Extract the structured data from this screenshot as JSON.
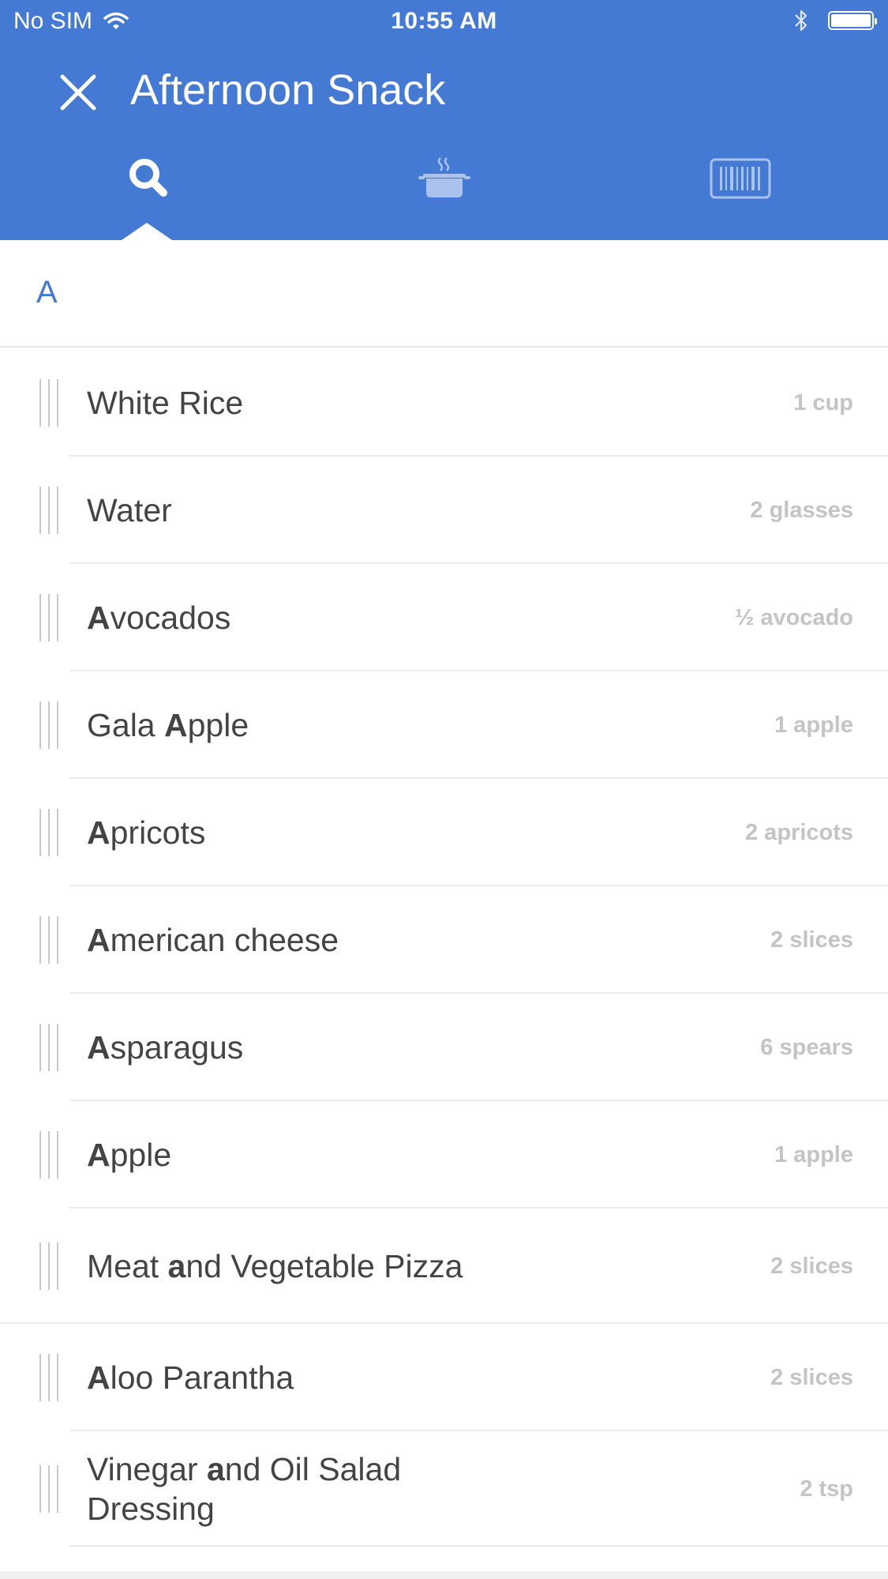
{
  "status_bar": {
    "carrier": "No SIM",
    "time": "10:55 AM",
    "wifi_icon": "wifi-icon",
    "bluetooth_icon": "bluetooth-icon",
    "battery_icon": "battery-icon"
  },
  "header": {
    "title": "Afternoon Snack",
    "close_icon": "close-icon",
    "tabs": [
      {
        "icon": "search-icon",
        "selected": true
      },
      {
        "icon": "cooking-pot-icon",
        "selected": false
      },
      {
        "icon": "barcode-icon",
        "selected": false
      }
    ]
  },
  "search": {
    "value": "A",
    "placeholder": ""
  },
  "foods": [
    {
      "pre": "White Rice",
      "bold": "",
      "post": "",
      "amount": "1 cup"
    },
    {
      "pre": "Water",
      "bold": "",
      "post": "",
      "amount": "2 glasses"
    },
    {
      "pre": "",
      "bold": "A",
      "post": "vocados",
      "amount": "½ avocado"
    },
    {
      "pre": "Gala ",
      "bold": "A",
      "post": "pple",
      "amount": "1 apple"
    },
    {
      "pre": "",
      "bold": "A",
      "post": "pricots",
      "amount": "2 apricots"
    },
    {
      "pre": "",
      "bold": "A",
      "post": "merican cheese",
      "amount": "2 slices"
    },
    {
      "pre": "",
      "bold": "A",
      "post": "sparagus",
      "amount": "6 spears"
    },
    {
      "pre": "",
      "bold": "A",
      "post": "pple",
      "amount": "1 apple"
    },
    {
      "pre": "Meat ",
      "bold": "a",
      "post": "nd Vegetable Pizza",
      "amount": "2 slices"
    },
    {
      "pre": "",
      "bold": "A",
      "post": "loo Parantha",
      "amount": "2 slices"
    },
    {
      "pre": "Vinegar ",
      "bold": "a",
      "post": "nd Oil Salad Dressing",
      "amount": "2 tsp"
    }
  ],
  "colors": {
    "header": "#4479d4",
    "query_text": "#4479d4",
    "food_text": "#444444",
    "amount_text": "#c4c4c4"
  }
}
